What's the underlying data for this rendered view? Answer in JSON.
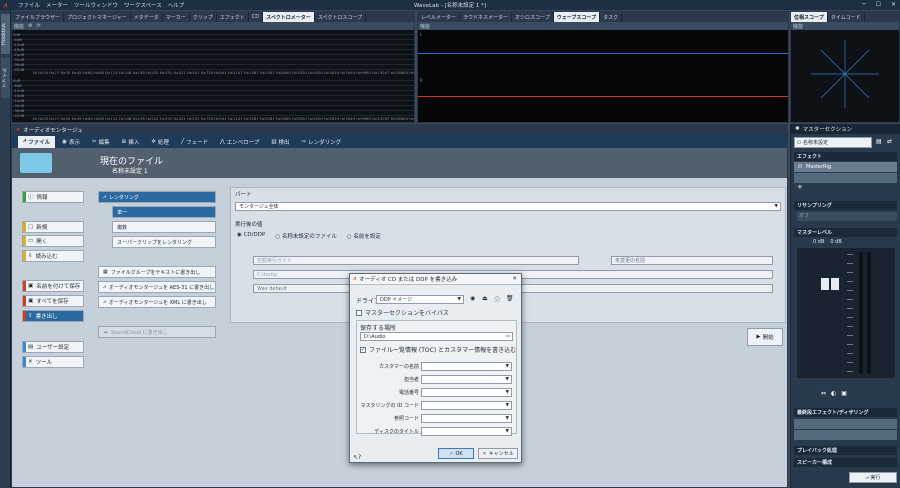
{
  "app": {
    "title": "WaveLab - [名称未設定 1 *]",
    "menu": [
      "ファイル",
      "メーター",
      "ツールウィンドウ",
      "ワークスペース",
      "ヘルプ"
    ]
  },
  "side_tabs": [
    "Hookbus",
    "ファイル"
  ],
  "top_left": {
    "tabs": [
      "ファイルブラウザー",
      "プロジェクトマネージャー",
      "メタデータ",
      "マーカー",
      "クリップ",
      "エフェクト",
      "CD",
      "スペクトロメーター",
      "スペクトロスコープ"
    ],
    "active_tab": "スペクトロメーター",
    "sub_label": "機能",
    "db_labels": [
      "0dB",
      "-6dB",
      "-12dB",
      "-18dB",
      "-24dB",
      "-30dB",
      "-36dB",
      "-42dB",
      "-48dB",
      "-54dB",
      "-60dB",
      "-66dB",
      "-72dB",
      "-78dB",
      "-84dB",
      "-90dB"
    ],
    "freq_labels": [
      "16 Hz",
      "20 Hz",
      "27 Hz",
      "35 Hz",
      "45 Hz",
      "60 Hz",
      "80 Hz",
      "114 Hz",
      "148 Hz",
      "195 Hz",
      "252 Hz",
      "331 Hz",
      "421 Hz",
      "551 Hz",
      "720 Hz",
      "941 Hz",
      "1147 Hz",
      "1587 Hz",
      "2087 Hz",
      "2695 Hz",
      "3520 Hz",
      "4500 Hz",
      "5819 Hz",
      "7649 Hz",
      "9985 Hz",
      "13047 Hz",
      "16604 Hz"
    ]
  },
  "top_mid": {
    "tabs": [
      "レベルメーター",
      "ラウドネスメーター",
      "オシロスコープ",
      "ウェーブスコープ",
      "タスク"
    ],
    "active_tab": "ウェーブスコープ",
    "sub_label": "機能",
    "labels": [
      "L",
      "R"
    ]
  },
  "top_right": {
    "tabs": [
      "位相スコープ",
      "タイムコード"
    ],
    "active_tab": "位相スコープ",
    "sub_label": "機能"
  },
  "audio_montage": {
    "panel_title": "オーディオモンタージュ",
    "ribbon": [
      "ファイル",
      "表示",
      "編集",
      "挿入",
      "処理",
      "フェード",
      "エンベロープ",
      "検出",
      "レンダリング"
    ],
    "active_ribbon": "ファイル",
    "header_title": "現在のファイル",
    "header_file": "名称未設定 1",
    "left_nav": [
      "情報",
      "新規",
      "開く",
      "読み込む",
      "名前を付けて保存",
      "すべてを保存",
      "書き出し",
      "ユーザー設定",
      "ツール"
    ],
    "selected_nav": "書き出し",
    "sub_items": [
      "レンダリング",
      "単一",
      "複数",
      "スーパークリップをレンダリング",
      "ファイルグループをテキストに書き出し",
      "オーディオモンタージュを AES-31 に書き出し",
      "オーディオモンタージュを XML に書き出し",
      "SoundCloud に書き出し"
    ],
    "part_label": "パート",
    "part_value": "モンタージュ全体",
    "process_label": "実行後の値",
    "radio_options": [
      "CD/DDP",
      "名称未設定のファイル",
      "名前を設定"
    ],
    "faded_fields": [
      "自動実行ガイド",
      "未変更の名前",
      "C:\\temp",
      "Wav default"
    ],
    "start_button": "開始"
  },
  "dialog": {
    "title": "オーディオ CD または DDP を書き込み",
    "drive_label": "ドライブ",
    "drive_value": "DDP イメージ",
    "bypass_master": "マスターセクションをバイパス",
    "save_location_label": "保存する場所",
    "save_location_value": "D:\\Audio",
    "toc_checkbox": "ファイル一覧情報 (TOC) とカスタマー情報を書き込む",
    "fields": [
      "カスタマーの名前",
      "担当者",
      "電話番号",
      "マスタリングの ID コード",
      "参照コード",
      "ディスクのタイトル"
    ],
    "ok": "OK",
    "cancel": "キャンセル"
  },
  "master": {
    "title": "マスターセクション",
    "preset_button": "名称未設定",
    "effects_label": "エフェクト",
    "effect_slot": "MasterRig",
    "resampling_label": "リサンプリング",
    "resampling_value": "オフ",
    "master_level_label": "マスターレベル",
    "level_values": [
      "0 dB",
      "0 dB"
    ],
    "final_label": "最終段エフェクト/ディザリング",
    "playback_label": "プレイバック処理",
    "speaker_label": "スピーカー構成",
    "render_button": "実行"
  },
  "colors": {
    "accent": "#2b6aa0",
    "ribbon": "#1f3b5a",
    "waveline": "#2a6ad0",
    "waveline_r": "#c04020",
    "phase": "#3a78c8"
  }
}
